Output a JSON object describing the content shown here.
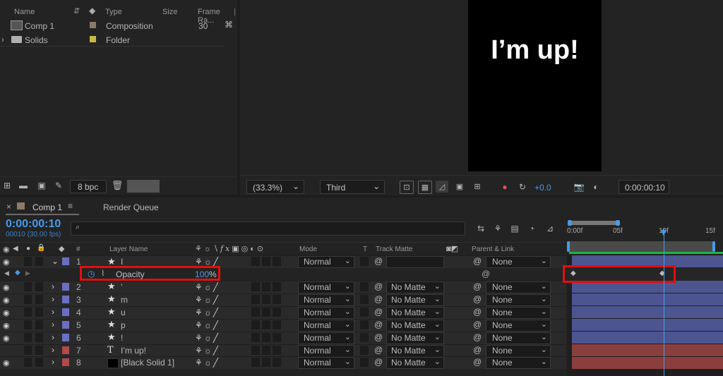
{
  "project": {
    "columns": {
      "name": "Name",
      "type": "Type",
      "size": "Size",
      "frame_rate": "Frame Ra..."
    },
    "items": [
      {
        "name": "Comp 1",
        "type": "Composition",
        "frame_rate": "30",
        "color": "#8a7a6a"
      },
      {
        "name": "Solids",
        "type": "Folder",
        "frame_rate": "",
        "color": "#c8b844"
      }
    ],
    "footer": {
      "bpc": "8 bpc"
    }
  },
  "viewer": {
    "text": "I’m up!",
    "toolbar": {
      "zoom": "(33.3%)",
      "view": "Third",
      "exposure": "+0.0",
      "timecode": "0:00:00:10"
    }
  },
  "timeline": {
    "tabs": [
      {
        "label": "Comp 1"
      },
      {
        "label": "Render Queue"
      }
    ],
    "timecode": "0:00:00:10",
    "frame_info": "00010 (30.00 fps)",
    "search_placeholder": "",
    "headers": {
      "layer_name": "Layer Name",
      "mode": "Mode",
      "t": "T",
      "track_matte": "Track Matte",
      "parent": "Parent & Link",
      "num": "#"
    },
    "ruler": [
      "0:00f",
      "05f",
      "10f",
      "15f"
    ],
    "property": {
      "name": "Opacity",
      "value": "100",
      "unit": "%"
    },
    "layers": [
      {
        "num": "1",
        "name": "I",
        "type": "star",
        "mode": "Normal",
        "matte": "",
        "parent": "None",
        "color": "#6a6fc4",
        "visible": true
      },
      {
        "num": "2",
        "name": "’",
        "type": "star",
        "mode": "Normal",
        "matte": "No Matte",
        "parent": "None",
        "color": "#6a6fc4",
        "visible": true
      },
      {
        "num": "3",
        "name": "m",
        "type": "star",
        "mode": "Normal",
        "matte": "No Matte",
        "parent": "None",
        "color": "#6a6fc4",
        "visible": true
      },
      {
        "num": "4",
        "name": "u",
        "type": "star",
        "mode": "Normal",
        "matte": "No Matte",
        "parent": "None",
        "color": "#6a6fc4",
        "visible": true
      },
      {
        "num": "5",
        "name": "p",
        "type": "star",
        "mode": "Normal",
        "matte": "No Matte",
        "parent": "None",
        "color": "#6a6fc4",
        "visible": true
      },
      {
        "num": "6",
        "name": "!",
        "type": "star",
        "mode": "Normal",
        "matte": "No Matte",
        "parent": "None",
        "color": "#6a6fc4",
        "visible": true
      },
      {
        "num": "7",
        "name": "I’m up!",
        "type": "text",
        "mode": "Normal",
        "matte": "No Matte",
        "parent": "None",
        "color": "#b14a4a",
        "visible": false
      },
      {
        "num": "8",
        "name": "[Black Solid 1]",
        "type": "solid",
        "mode": "Normal",
        "matte": "No Matte",
        "parent": "None",
        "color": "#b14a4a",
        "visible": true
      }
    ]
  },
  "colors": {
    "accent": "#3f8fe8",
    "highlight": "#e01010",
    "timecode": "#4a9ae8"
  }
}
